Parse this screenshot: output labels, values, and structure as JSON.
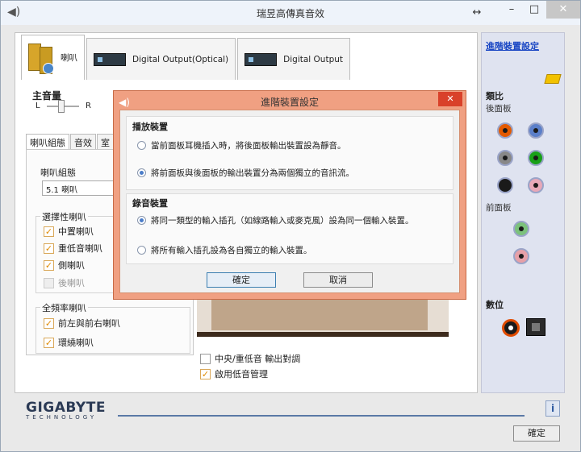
{
  "window": {
    "title": "瑞昱高傳真音效",
    "resize_glyph": "↔",
    "min_glyph": "–",
    "max_glyph": "□",
    "close_glyph": "✕"
  },
  "device_tabs": [
    {
      "label": "喇叭",
      "icon": "speaker-icon"
    },
    {
      "label": "Digital Output(Optical)",
      "icon": "optical-output-icon"
    },
    {
      "label": "Digital Output",
      "icon": "digital-output-icon"
    }
  ],
  "master_volume": {
    "label": "主音量",
    "left": "L",
    "right": "R"
  },
  "sub_tabs": [
    "喇叭組態",
    "音效",
    "室"
  ],
  "speaker_config": {
    "group_label": "喇叭組態",
    "selected": "5.1 喇叭",
    "optional_group": "選擇性喇叭",
    "optional": [
      {
        "label": "中置喇叭",
        "checked": true,
        "disabled": false
      },
      {
        "label": "重低音喇叭",
        "checked": true,
        "disabled": false
      },
      {
        "label": "側喇叭",
        "checked": true,
        "disabled": false
      },
      {
        "label": "後喇叭",
        "checked": false,
        "disabled": true
      }
    ],
    "fullrange_group": "全頻率喇叭",
    "fullrange": [
      {
        "label": "前左與前右喇叭",
        "checked": true
      },
      {
        "label": "環繞喇叭",
        "checked": true
      }
    ]
  },
  "bottom_options": [
    {
      "label": "中央/重低音 輸出對調",
      "checked": false
    },
    {
      "label": "啟用低音管理",
      "checked": true
    }
  ],
  "sidebar": {
    "advanced_link": "進階裝置設定",
    "analog_title": "類比",
    "back_panel": "後面板",
    "front_panel": "前面板",
    "digital_title": "數位",
    "colors": {
      "orange": "#e35a00",
      "blue": "#5b7fc9",
      "gray": "#888888",
      "green": "#18a018",
      "black": "#1a1a1a",
      "pink": "#e8a8b8",
      "front_green": "#7cc27c",
      "front_pink": "#e6a0a8"
    }
  },
  "footer": {
    "logo": "GIGABYTE",
    "logo_sub": "TECHNOLOGY",
    "info_icon": "i",
    "ok_label": "確定"
  },
  "dialog": {
    "title": "進階裝置設定",
    "close_glyph": "✕",
    "playback_title": "播放裝置",
    "playback_options": [
      {
        "label": "當前面板耳機插入時，將後面板輸出裝置設為靜音。",
        "selected": false
      },
      {
        "label": "將前面板與後面板的輸出裝置分為兩個獨立的音訊流。",
        "selected": true
      }
    ],
    "record_title": "錄音裝置",
    "record_options": [
      {
        "label": "將同一類型的輸入插孔（如線路輸入或麥克風）設為同一個輸入裝置。",
        "selected": true
      },
      {
        "label": "將所有輸入插孔設為各自獨立的輸入裝置。",
        "selected": false
      }
    ],
    "ok_label": "確定",
    "cancel_label": "取消"
  }
}
